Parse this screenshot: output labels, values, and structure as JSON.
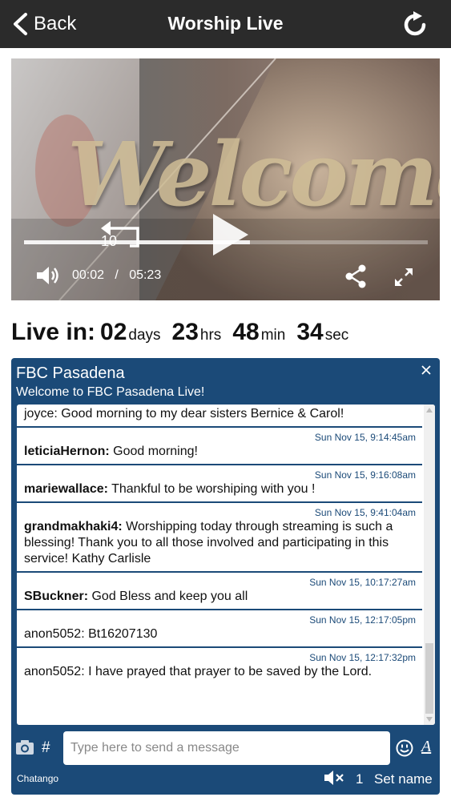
{
  "nav": {
    "back_label": "Back",
    "title": "Worship Live",
    "refresh_icon": "refresh-icon"
  },
  "video": {
    "overlay_text": "Welcome",
    "rewind_seconds": "10",
    "current_time": "00:02",
    "separator": "/",
    "duration": "05:23",
    "progress_fraction": 0.56
  },
  "countdown": {
    "label": "Live in:",
    "days": "02",
    "days_unit": "days",
    "hours": "23",
    "hours_unit": "hrs",
    "minutes": "48",
    "minutes_unit": "min",
    "seconds": "34",
    "seconds_unit": "sec"
  },
  "chat": {
    "title": "FBC Pasadena",
    "subtitle": "Welcome to FBC Pasadena Live!",
    "messages": [
      {
        "time": "",
        "user": "",
        "text": "joyce: Good morning to my dear sisters Bernice & Carol!"
      },
      {
        "time": "Sun Nov 15, 9:14:45am",
        "user": "leticiaHernon:",
        "text": " Good morning!"
      },
      {
        "time": "Sun Nov 15, 9:16:08am",
        "user": "mariewallace:",
        "text": " Thankful to be worshiping with you !"
      },
      {
        "time": "Sun Nov 15, 9:41:04am",
        "user": "grandmakhaki4:",
        "text": " Worshipping today through streaming is such a blessing! Thank you to all those involved and participating in this service! Kathy Carlisle"
      },
      {
        "time": "Sun Nov 15, 10:17:27am",
        "user": "SBuckner:",
        "text": " God Bless and keep you all"
      },
      {
        "time": "Sun Nov 15, 12:17:05pm",
        "user": "",
        "text": "anon5052: Bt16207130"
      },
      {
        "time": "Sun Nov 15, 12:17:32pm",
        "user": "",
        "text": "anon5052: I have prayed that prayer to be saved by the Lord."
      }
    ],
    "hash_label": "#",
    "input_placeholder": "Type here to send a message",
    "format_label": "A",
    "brand": "Chatango",
    "user_count": "1",
    "set_name_label": "Set name"
  },
  "colors": {
    "nav_bg": "#2b2b2b",
    "chat_bg": "#1b4a78"
  }
}
